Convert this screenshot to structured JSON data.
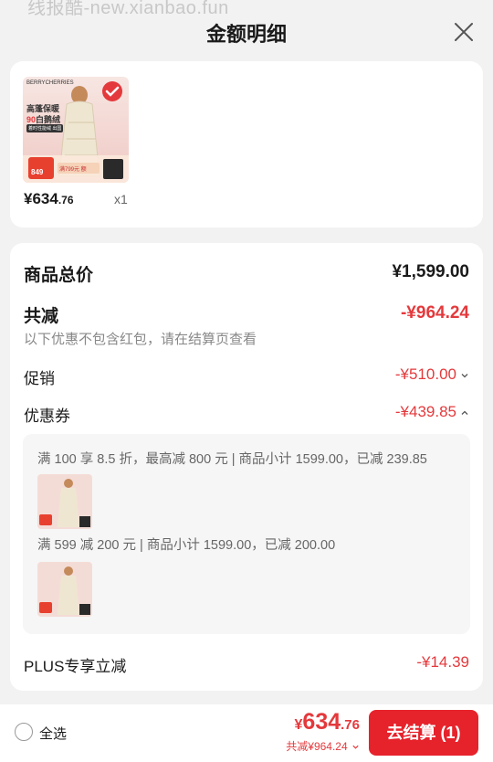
{
  "watermark": "线报酷-new.xianbao.fun",
  "header": {
    "title": "金额明细"
  },
  "product": {
    "price_int": "¥634",
    "price_dec": ".76",
    "qty": "x1",
    "thumb_brand": "BERRYCHERRIES",
    "thumb_text1": "高蓬保暖",
    "thumb_text2": "90",
    "thumb_text3": "白鹅绒",
    "thumb_tag": "满799元 额",
    "thumb_price": "849",
    "thumb_badge": "着时性能绒 出国"
  },
  "summary": {
    "total_label": "商品总价",
    "total_value": "¥1,599.00",
    "reduce_label": "共减",
    "reduce_value": "-¥964.24",
    "note": "以下优惠不包含红包，请在结算页查看",
    "promo_label": "促销",
    "promo_value": "-¥510.00",
    "coupon_label": "优惠券",
    "coupon_value": "-¥439.85",
    "plus_label": "PLUS专享立减",
    "plus_value": "-¥14.39"
  },
  "coupons": [
    {
      "text": "满 100 享 8.5 折，最高减 800 元 | 商品小计 1599.00，已减 239.85"
    },
    {
      "text": "满 599 减 200 元 | 商品小计 1599.00，已减 200.00"
    }
  ],
  "bottom": {
    "select_all": "全选",
    "yen": "¥",
    "total_int": "634",
    "total_dec": ".76",
    "reduce_text": "共减¥964.24",
    "checkout_label": "去结算 (1)"
  },
  "colors": {
    "accent": "#e4393c",
    "button": "#e6222b"
  },
  "icons": {
    "close": "close-icon",
    "promo_chevron": "chevron-down-icon",
    "coupon_chevron": "chevron-up-icon",
    "checked": "check-badge-icon"
  }
}
